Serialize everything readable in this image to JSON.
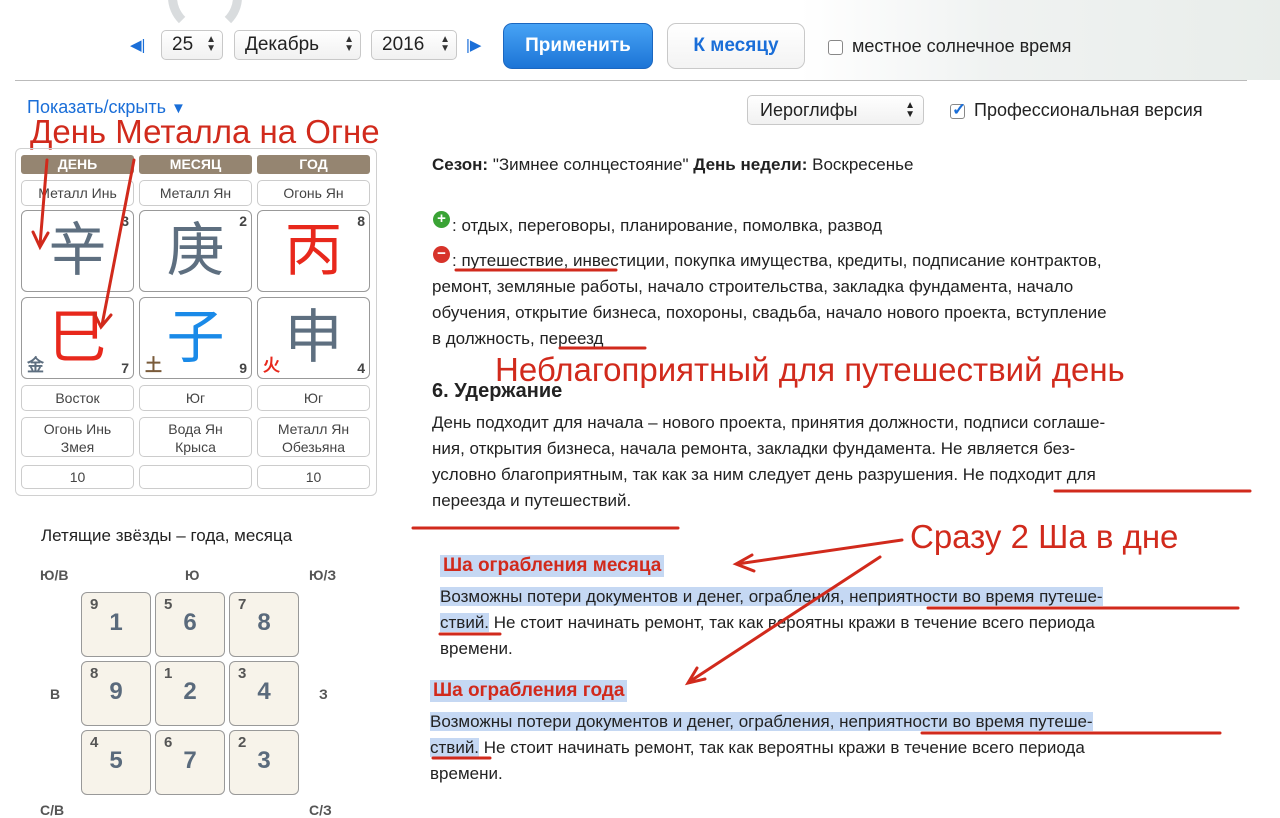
{
  "nav": {
    "day": "25",
    "month": "Декабрь",
    "year": "2016",
    "apply_label": "Применить",
    "to_month_label": "К месяцу",
    "solar_time_label": "местное солнечное время"
  },
  "toolbar": {
    "show_hide_label": "Показать/скрыть",
    "display_mode": "Иероглифы",
    "pro_label": "Профессиональная версия"
  },
  "annotations": {
    "metal_on_fire": "День Металла на Огне",
    "bad_travel_day": "Неблагоприятный для путешествий день",
    "two_sha": "Сразу 2 Ша в дне"
  },
  "pillars": {
    "headers": [
      "ДЕНЬ",
      "МЕСЯЦ",
      "ГОД"
    ],
    "stems_label": [
      "Металл Инь",
      "Металл Ян",
      "Огонь Ян"
    ],
    "stems": [
      {
        "glyph": "辛",
        "num": "3",
        "color": "#5e6f80"
      },
      {
        "glyph": "庚",
        "num": "2",
        "color": "#5e6f80"
      },
      {
        "glyph": "丙",
        "num": "8",
        "color": "#e8281c"
      }
    ],
    "branches": [
      {
        "glyph": "巳",
        "num": "7",
        "element": "金",
        "color": "#e8281c",
        "element_color": "#5e6f80"
      },
      {
        "glyph": "子",
        "num": "9",
        "element": "土",
        "color": "#1a8ae8",
        "element_color": "#7a5b3a"
      },
      {
        "glyph": "申",
        "num": "4",
        "element": "火",
        "color": "#5e6f80",
        "element_color": "#e8281c"
      }
    ],
    "directions": [
      "Восток",
      "Юг",
      "Юг"
    ],
    "branch_desc": [
      [
        "Огонь Инь",
        "Змея"
      ],
      [
        "Вода Ян",
        "Крыса"
      ],
      [
        "Металл Ян",
        "Обезьяна"
      ]
    ],
    "numbers": [
      "10",
      "",
      "10"
    ]
  },
  "flying_stars": {
    "title": "Летящие звёзды – года, месяца",
    "dirs": {
      "nw": "Ю/В",
      "n": "Ю",
      "ne": "Ю/З",
      "w": "В",
      "e": "З",
      "sw": "С/В",
      "se": "С/З"
    },
    "cells": [
      {
        "small": "9",
        "big": "1"
      },
      {
        "small": "5",
        "big": "6"
      },
      {
        "small": "7",
        "big": "8"
      },
      {
        "small": "8",
        "big": "9"
      },
      {
        "small": "1",
        "big": "2"
      },
      {
        "small": "3",
        "big": "4"
      },
      {
        "small": "4",
        "big": "5"
      },
      {
        "small": "6",
        "big": "7"
      },
      {
        "small": "2",
        "big": "3"
      }
    ]
  },
  "info": {
    "season_label": "Сезон:",
    "season_value": "\"Зимнее солнцестояние\"",
    "weekday_label": "День недели:",
    "weekday_value": "Воскресенье",
    "good": ": отдых, переговоры, планирование, помолвка, развод",
    "bad_lines": [
      ": путешествие, инвестиции, покупка имущества, кредиты, подписание контрактов,",
      "ремонт, земляные работы, начало строительства, закладка фундамента, начало",
      "обучения, открытие бизнеса, похороны, свадьба, начало нового проекта, вступление",
      "в должность, переезд"
    ],
    "officer_title": "6. Удержание",
    "officer_lines": [
      "День подходит для начала – нового проекта, принятия должности, подписи соглаше-",
      "ния, открытия бизнеса, начала ремонта, закладки фундамента. Не является без-",
      "условно благоприятным, так как за ним следует день разрушения. Не подходит для",
      "переезда и путешествий."
    ],
    "sha_month_title": "Ша ограбления месяца",
    "sha_month_lines": [
      "Возможны потери документов и денег, ограбления, неприятности во время путеше-",
      "ствий.",
      " Не стоит начинать ремонт, так как вероятны кражи в течение всего периода",
      "времени."
    ],
    "sha_year_title": "Ша ограбления года",
    "sha_year_lines": [
      "Возможны потери документов и денег, ограбления, неприятности во время путеше-",
      "ствий.",
      " Не стоит начинать ремонт, так как вероятны кражи в течение всего периода",
      "времени."
    ]
  }
}
